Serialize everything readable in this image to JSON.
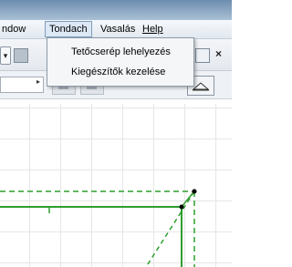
{
  "menubar": {
    "items": [
      {
        "label": "ndow",
        "underline": ""
      },
      {
        "label": "Tondach",
        "underline": ""
      },
      {
        "label": "Vasalás",
        "underline": ""
      },
      {
        "label": "Help",
        "underline": "H"
      }
    ],
    "active_index": 1
  },
  "dropdown": {
    "items": [
      {
        "label": "Tetőcserép lehelyezés"
      },
      {
        "label": "Kiegészítők kezelése"
      }
    ]
  },
  "toolbar": {
    "close_glyph": "×"
  },
  "icons": {
    "dropdown_arrow": "▾",
    "side_arrow": "▸"
  },
  "colors": {
    "menu_highlight": "#dce8f5",
    "line_green": "#2e9e2e",
    "vertex": "#000000"
  }
}
